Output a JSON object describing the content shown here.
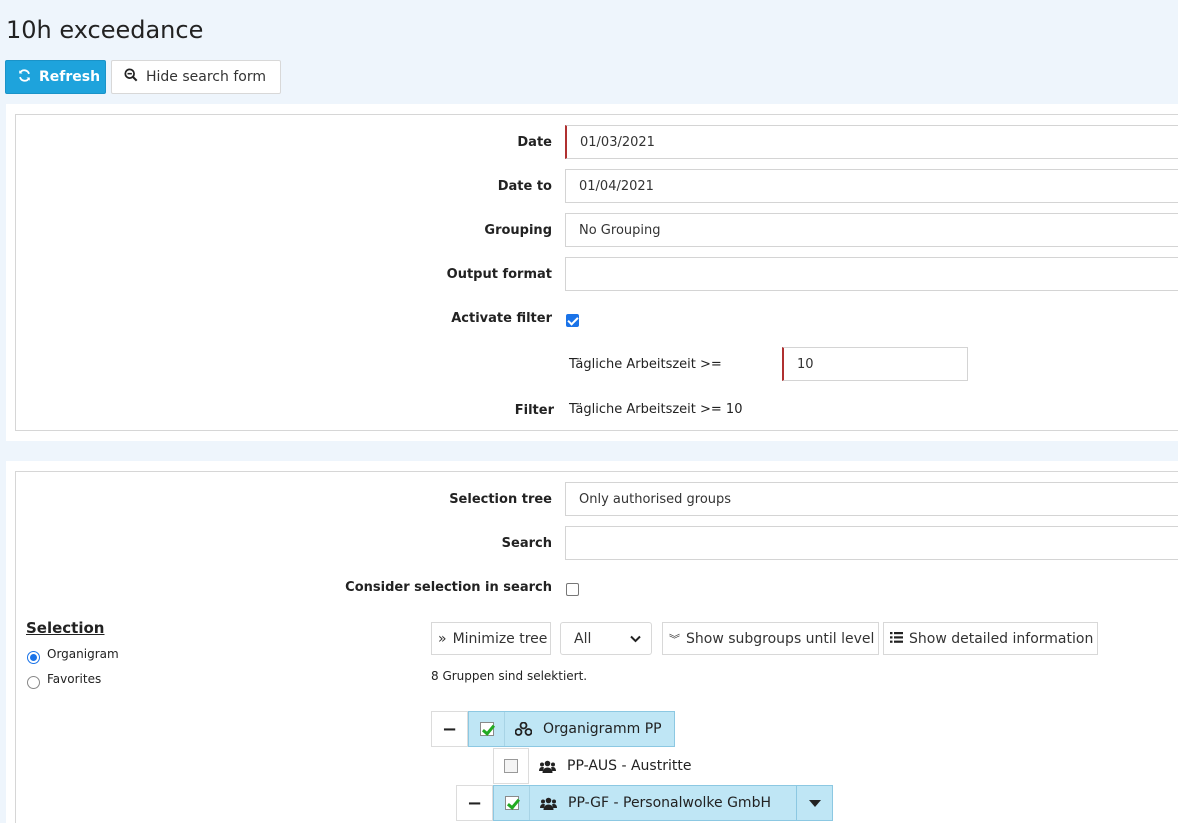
{
  "page": {
    "title": "10h exceedance"
  },
  "toolbar": {
    "refresh_label": "Refresh",
    "hide_search_label": "Hide search form"
  },
  "form": {
    "date_label": "Date",
    "date_value": "01/03/2021",
    "date_to_label": "Date to",
    "date_to_value": "01/04/2021",
    "grouping_label": "Grouping",
    "grouping_value": "No Grouping",
    "output_format_label": "Output format",
    "output_format_value": "",
    "activate_filter_label": "Activate filter",
    "activate_filter_checked": true,
    "filter_condition_label": "Tägliche Arbeitszeit >=",
    "filter_condition_value": "10",
    "filter_label": "Filter",
    "filter_summary": "Tägliche Arbeitszeit >= 10"
  },
  "selection": {
    "selection_tree_label": "Selection tree",
    "selection_tree_value": "Only authorised groups",
    "search_label": "Search",
    "search_value": "",
    "consider_label": "Consider selection in search",
    "consider_checked": false,
    "heading": "Selection",
    "radio_organigram": "Organigram",
    "radio_favorites": "Favorites",
    "selected_radio": "Organigram",
    "minimize_tree_label": "Minimize tree",
    "level_select_value": "All",
    "show_subgroups_label": "Show subgroups until level",
    "show_detailed_label": "Show detailed information",
    "selected_count_text": "8 Gruppen sind selektiert.",
    "tree": [
      {
        "label": "Organigramm PP",
        "checked": true,
        "icon": "sitemap-icon"
      },
      {
        "label": "PP-AUS - Austritte",
        "checked": false,
        "icon": "users-icon"
      },
      {
        "label": "PP-GF - Personalwolke GmbH",
        "checked": true,
        "icon": "users-icon"
      }
    ]
  },
  "colors": {
    "accent": "#1ea3dc",
    "selected_node": "#bfe6f5",
    "required_marker": "#b03030"
  }
}
